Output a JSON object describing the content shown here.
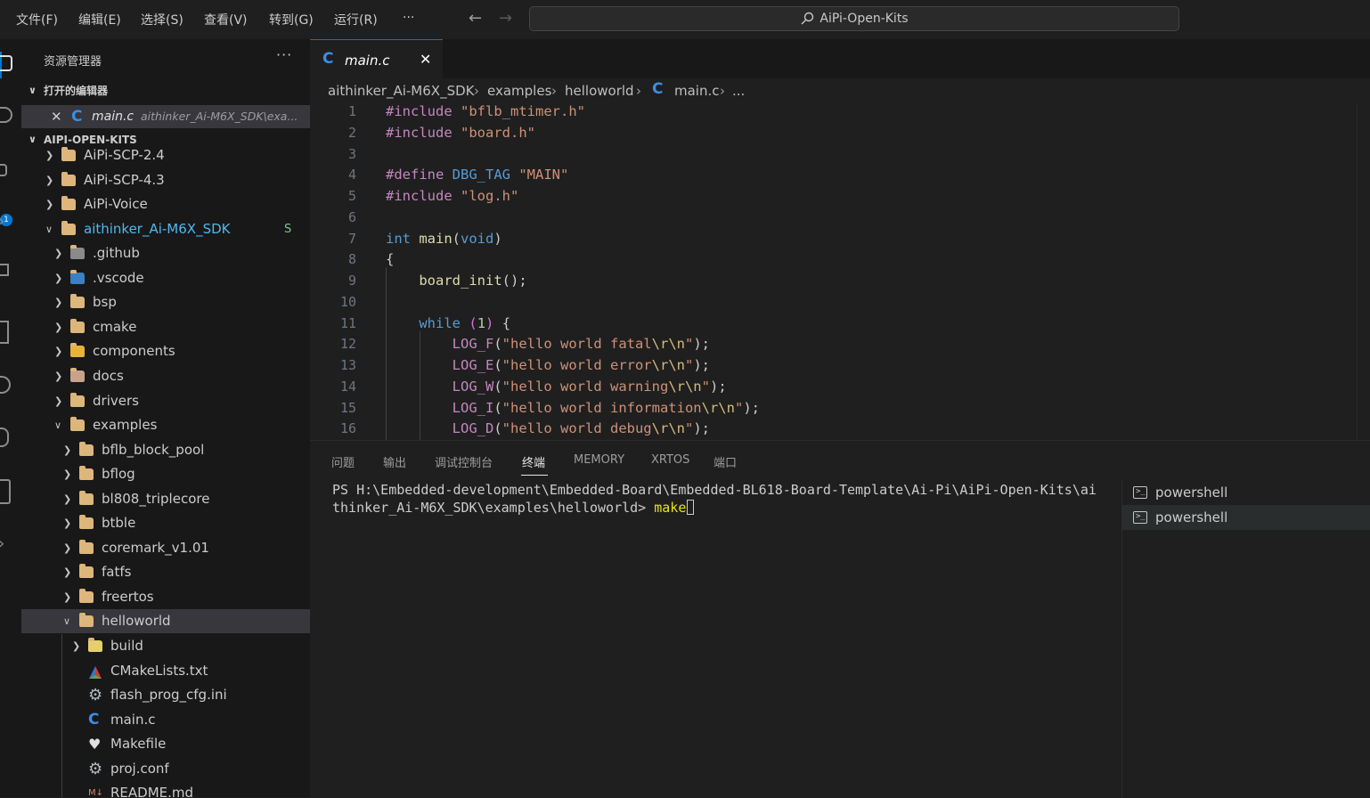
{
  "menu": [
    "文件(F)",
    "编辑(E)",
    "选择(S)",
    "查看(V)",
    "转到(G)",
    "运行(R)",
    "···"
  ],
  "search": {
    "text": "AiPi-Open-Kits"
  },
  "activity": {
    "badge": "1"
  },
  "sidebar": {
    "title": "资源管理器",
    "more": "···",
    "open_editors_label": "打开的编辑器",
    "open_editor": {
      "name": "main.c",
      "path": "aithinker_Ai-M6X_SDK\\exa..."
    },
    "workspace_label": "AIPI-OPEN-KITS",
    "tree": [
      {
        "name": "AiPi-SCP-2.4"
      },
      {
        "name": "AiPi-SCP-4.3"
      },
      {
        "name": "AiPi-Voice"
      },
      {
        "name": "aithinker_Ai-M6X_SDK",
        "badge": "S"
      },
      {
        "name": ".github"
      },
      {
        "name": ".vscode"
      },
      {
        "name": "bsp"
      },
      {
        "name": "cmake"
      },
      {
        "name": "components"
      },
      {
        "name": "docs"
      },
      {
        "name": "drivers"
      },
      {
        "name": "examples"
      },
      {
        "name": "bflb_block_pool"
      },
      {
        "name": "bflog"
      },
      {
        "name": "bl808_triplecore"
      },
      {
        "name": "btble"
      },
      {
        "name": "coremark_v1.01"
      },
      {
        "name": "fatfs"
      },
      {
        "name": "freertos"
      },
      {
        "name": "helloworld"
      },
      {
        "name": "build"
      },
      {
        "name": "CMakeLists.txt"
      },
      {
        "name": "flash_prog_cfg.ini"
      },
      {
        "name": "main.c"
      },
      {
        "name": "Makefile"
      },
      {
        "name": "proj.conf"
      },
      {
        "name": "README.md"
      }
    ]
  },
  "editor": {
    "tab_label": "main.c",
    "breadcrumb": [
      "aithinker_Ai-M6X_SDK",
      "examples",
      "helloworld",
      "main.c",
      "..."
    ],
    "lines": [
      {
        "n": "1",
        "t": "#include \"bflb_mtimer.h\""
      },
      {
        "n": "2",
        "t": "#include \"board.h\""
      },
      {
        "n": "3",
        "t": ""
      },
      {
        "n": "4",
        "t": "#define DBG_TAG \"MAIN\""
      },
      {
        "n": "5",
        "t": "#include \"log.h\""
      },
      {
        "n": "6",
        "t": ""
      },
      {
        "n": "7",
        "t": "int main(void)"
      },
      {
        "n": "8",
        "t": "{"
      },
      {
        "n": "9",
        "t": "    board_init();"
      },
      {
        "n": "10",
        "t": ""
      },
      {
        "n": "11",
        "t": "    while (1) {"
      },
      {
        "n": "12",
        "t": "        LOG_F(\"hello world fatal\\r\\n\");"
      },
      {
        "n": "13",
        "t": "        LOG_E(\"hello world error\\r\\n\");"
      },
      {
        "n": "14",
        "t": "        LOG_W(\"hello world warning\\r\\n\");"
      },
      {
        "n": "15",
        "t": "        LOG_I(\"hello world information\\r\\n\");"
      },
      {
        "n": "16",
        "t": "        LOG_D(\"hello world debug\\r\\n\");"
      }
    ]
  },
  "panel": {
    "tabs": [
      "问题",
      "输出",
      "调试控制台",
      "终端",
      "MEMORY",
      "XRTOS",
      "端口"
    ],
    "active_tab": "终端",
    "terminal": {
      "line1": "PS H:\\Embedded-development\\Embedded-Board\\Embedded-BL618-Board-Template\\Ai-Pi\\AiPi-Open-Kits\\ai",
      "line2_prefix": "thinker_Ai-M6X_SDK\\examples\\helloworld> ",
      "command": "make"
    },
    "terminals": [
      "powershell",
      "powershell"
    ]
  },
  "colors": {
    "accent": "#0078d4",
    "folder": "#dcb67a",
    "c_file": "#3d8ee6"
  }
}
